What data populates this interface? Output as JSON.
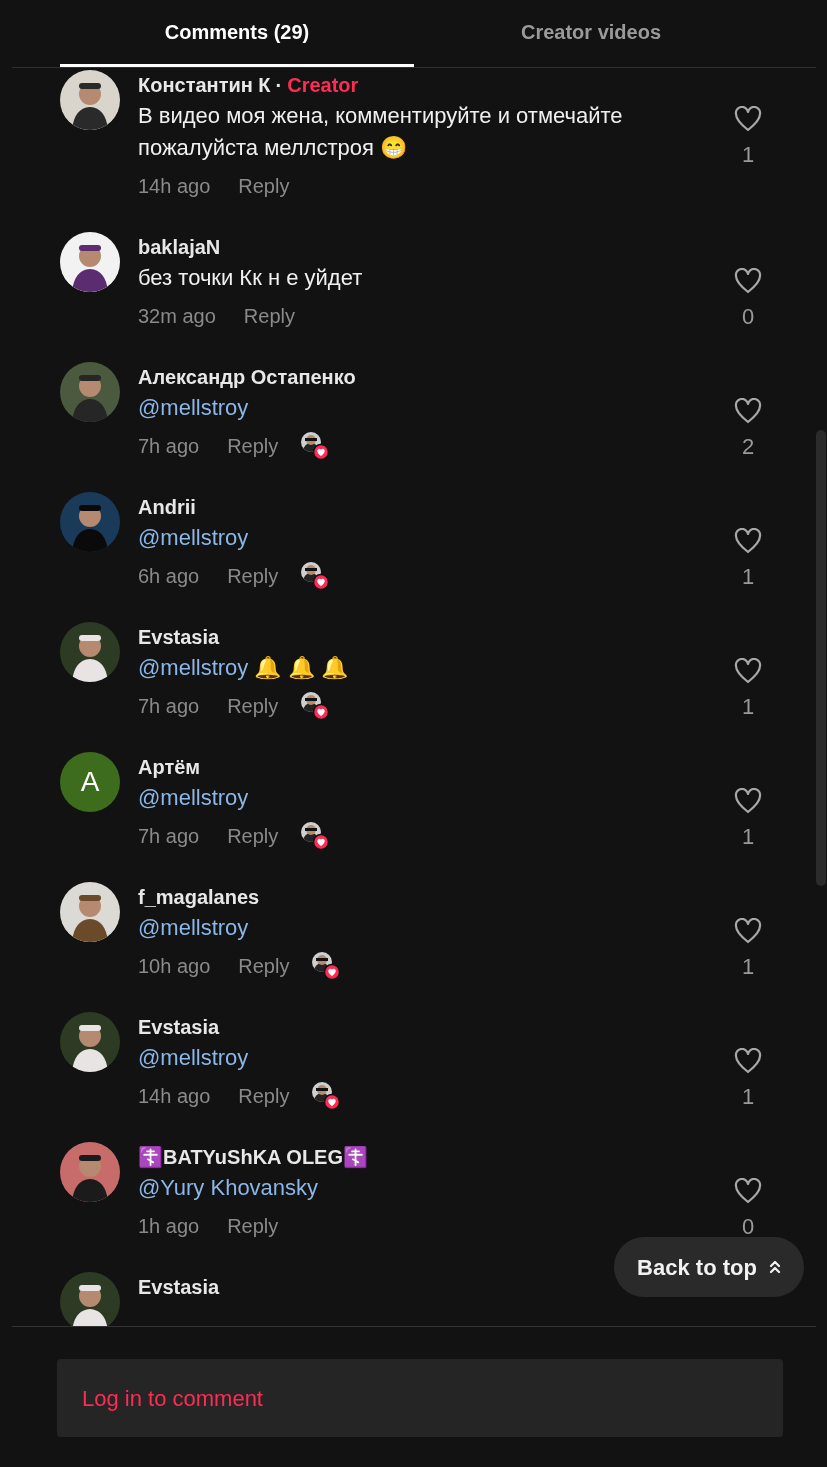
{
  "tabs": [
    {
      "label": "Comments (29)",
      "selected": true
    },
    {
      "label": "Creator videos",
      "selected": false
    }
  ],
  "comments": [
    {
      "avatar": {
        "kind": "picture"
      },
      "name": "Константин К",
      "separator": "·",
      "badge": "Creator",
      "segments": [
        {
          "kind": "plain",
          "text": "В видео моя жена, комментируйте и отмечайте пожалуйста меллстроя 😁"
        }
      ],
      "time": "14h ago",
      "reply": "Reply",
      "liked_by_creator": false,
      "likes": "1"
    },
    {
      "avatar": {
        "kind": "picture"
      },
      "name": "baklajaN",
      "segments": [
        {
          "kind": "plain",
          "text": "без точки Кк н е уйдет"
        }
      ],
      "time": "32m ago",
      "reply": "Reply",
      "liked_by_creator": false,
      "likes": "0"
    },
    {
      "avatar": {
        "kind": "picture"
      },
      "name": "Александр Остапенко",
      "segments": [
        {
          "kind": "mention",
          "text": "@mellstroy"
        }
      ],
      "time": "7h ago",
      "reply": "Reply",
      "liked_by_creator": true,
      "likes": "2"
    },
    {
      "avatar": {
        "kind": "picture"
      },
      "name": "Andrii",
      "segments": [
        {
          "kind": "mention",
          "text": "@mellstroy"
        }
      ],
      "time": "6h ago",
      "reply": "Reply",
      "liked_by_creator": true,
      "likes": "1"
    },
    {
      "avatar": {
        "kind": "picture"
      },
      "name": "Evstasia",
      "segments": [
        {
          "kind": "mention",
          "text": "@mellstroy"
        },
        {
          "kind": "plain",
          "text": " 🔔 🔔 🔔"
        }
      ],
      "time": "7h ago",
      "reply": "Reply",
      "liked_by_creator": true,
      "likes": "1"
    },
    {
      "avatar": {
        "kind": "letter",
        "letter": "A"
      },
      "name": "Артём",
      "segments": [
        {
          "kind": "mention",
          "text": "@mellstroy"
        }
      ],
      "time": "7h ago",
      "reply": "Reply",
      "liked_by_creator": true,
      "likes": "1"
    },
    {
      "avatar": {
        "kind": "picture"
      },
      "name": "f_magalanes",
      "segments": [
        {
          "kind": "mention",
          "text": "@mellstroy"
        }
      ],
      "time": "10h ago",
      "reply": "Reply",
      "liked_by_creator": true,
      "likes": "1"
    },
    {
      "avatar": {
        "kind": "picture"
      },
      "name": "Evstasia",
      "segments": [
        {
          "kind": "mention",
          "text": "@mellstroy"
        }
      ],
      "time": "14h ago",
      "reply": "Reply",
      "liked_by_creator": true,
      "likes": "1"
    },
    {
      "avatar": {
        "kind": "picture"
      },
      "name": "☦️BATYuShKA OLEG☦️",
      "segments": [
        {
          "kind": "mention",
          "text": "@Yury Khovansky"
        }
      ],
      "time": "1h ago",
      "reply": "Reply",
      "liked_by_creator": false,
      "likes": "0"
    },
    {
      "avatar": {
        "kind": "picture"
      },
      "name": "Evstasia"
    }
  ],
  "back_to_top": "Back to top",
  "login_prompt": "Log in to comment"
}
